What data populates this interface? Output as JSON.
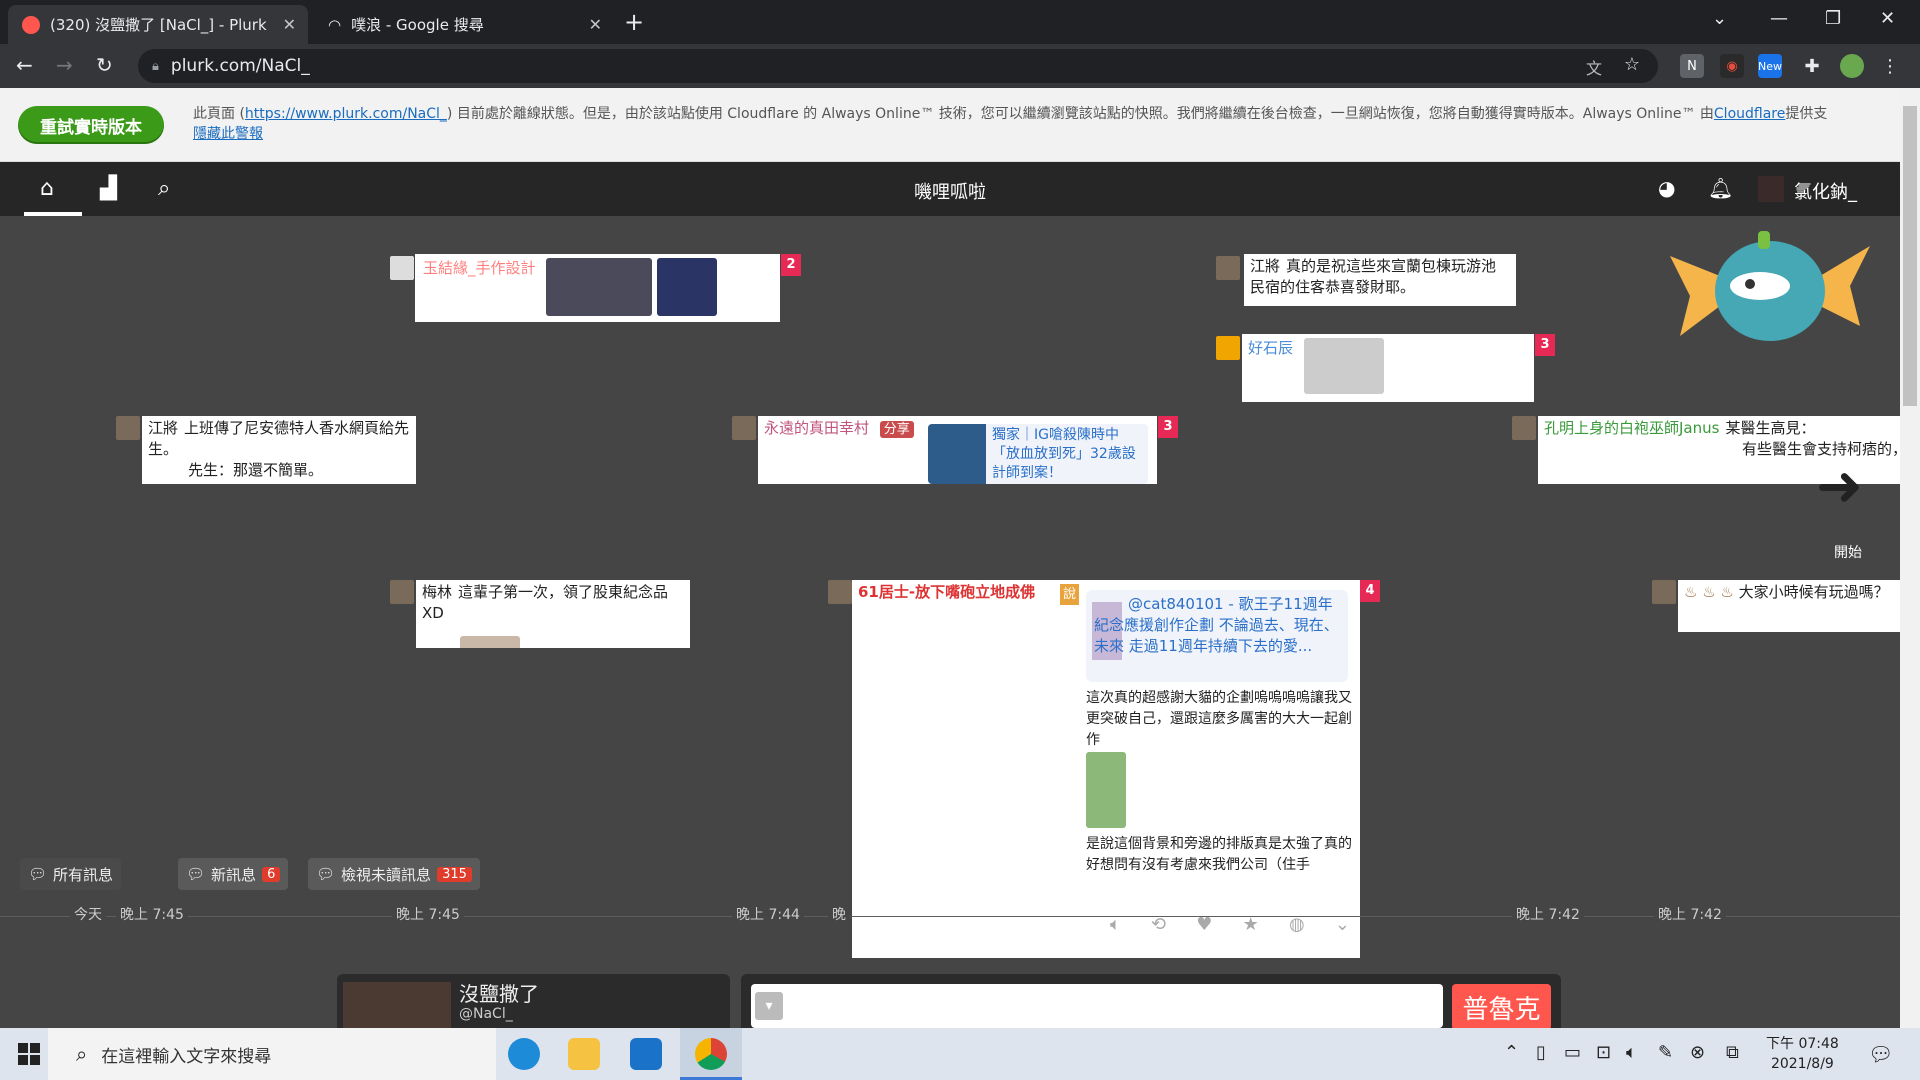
{
  "browser": {
    "tabs": [
      {
        "title": "(320) 沒鹽撒了 [NaCl_] - Plurk",
        "active": true
      },
      {
        "title": "噗浪 - Google 搜尋",
        "active": false
      }
    ],
    "new_tab": "+",
    "url": "plurk.com/NaCl_",
    "ext_new_label": "New"
  },
  "alert": {
    "retry_button": "重試實時版本",
    "text_1": "此頁面 (",
    "link_url": "https://www.plurk.com/NaCl_",
    "text_2": ") 目前處於離線狀態。但是，由於該站點使用 Cloudflare 的 Always Online™ 技術，您可以繼續瀏覽該站點的快照。我們將繼續在後台檢查，一旦網站恢復，您將自動獲得實時版本。Always Online™ 由",
    "link_cloudflare": "Cloudflare",
    "text_3": "提供支",
    "hide_link": "隱藏此警報"
  },
  "plurk_nav": {
    "title": "嘰哩呱啦",
    "username": "氯化鈉_"
  },
  "plurks": [
    {
      "name": "玉結緣_手作設計",
      "text": "",
      "count": "2"
    },
    {
      "name": "江將",
      "text": "真的是祝這些來宣蘭包棟玩游池民宿的住客恭喜發財耶。",
      "count": ""
    },
    {
      "name": "好石辰",
      "text": "",
      "count": "3"
    },
    {
      "name": "江將",
      "text": "上班傳了尼安德特人香水網頁給先生。",
      "text2": "先生：那還不簡單。",
      "count": ""
    },
    {
      "name": "永遠的真田幸村",
      "qual": "分享",
      "link": "獨家｜IG嗆殺陳時中「放血放到死」32歲設計師到案！",
      "count": "3"
    },
    {
      "name": "孔明上身的白袍巫師Janus",
      "text": "某醫生高見：",
      "text2": "有些醫生會支持柯痞的，是將自己代入角色，老",
      "count": ""
    },
    {
      "name": "梅林",
      "text": "這輩子第一次，領了股東紀念品XD",
      "count": ""
    },
    {
      "name": "61居士-放下嘴砲立地成佛",
      "qual": "說",
      "link": "@cat840101 - 歌王子11週年紀念應援創作企劃 不論過去、現在、未來 走過11週年持續下去的愛...",
      "text": "這次真的超感謝大貓的企劃嗚嗚嗚嗚讓我又更突破自己，還跟這麼多厲害的大大一起創作",
      "text2": "是說這個背景和旁邊的排版真是太強了真的好想問有沒有考慮來我們公司（住手",
      "count": "4"
    },
    {
      "name": "",
      "text": "大家小時候有玩過嗎？",
      "count": ""
    }
  ],
  "start_label": "開始",
  "filters": [
    {
      "label": "所有訊息",
      "count": ""
    },
    {
      "label": "新訊息",
      "count": "6"
    },
    {
      "label": "檢視未讀訊息",
      "count": "315"
    }
  ],
  "time_labels": [
    "今天",
    "晚上 7:45",
    "晚上 7:45",
    "晚上 7:44",
    "晚",
    "晚上 7:42",
    "晚上 7:42"
  ],
  "profile": {
    "display_name": "沒鹽撒了",
    "nick": "@NaCl_"
  },
  "compose": {
    "submit": "普魯克"
  },
  "taskbar": {
    "search_placeholder": "在這裡輸入文字來搜尋",
    "time": "下午 07:48",
    "date": "2021/8/9"
  }
}
